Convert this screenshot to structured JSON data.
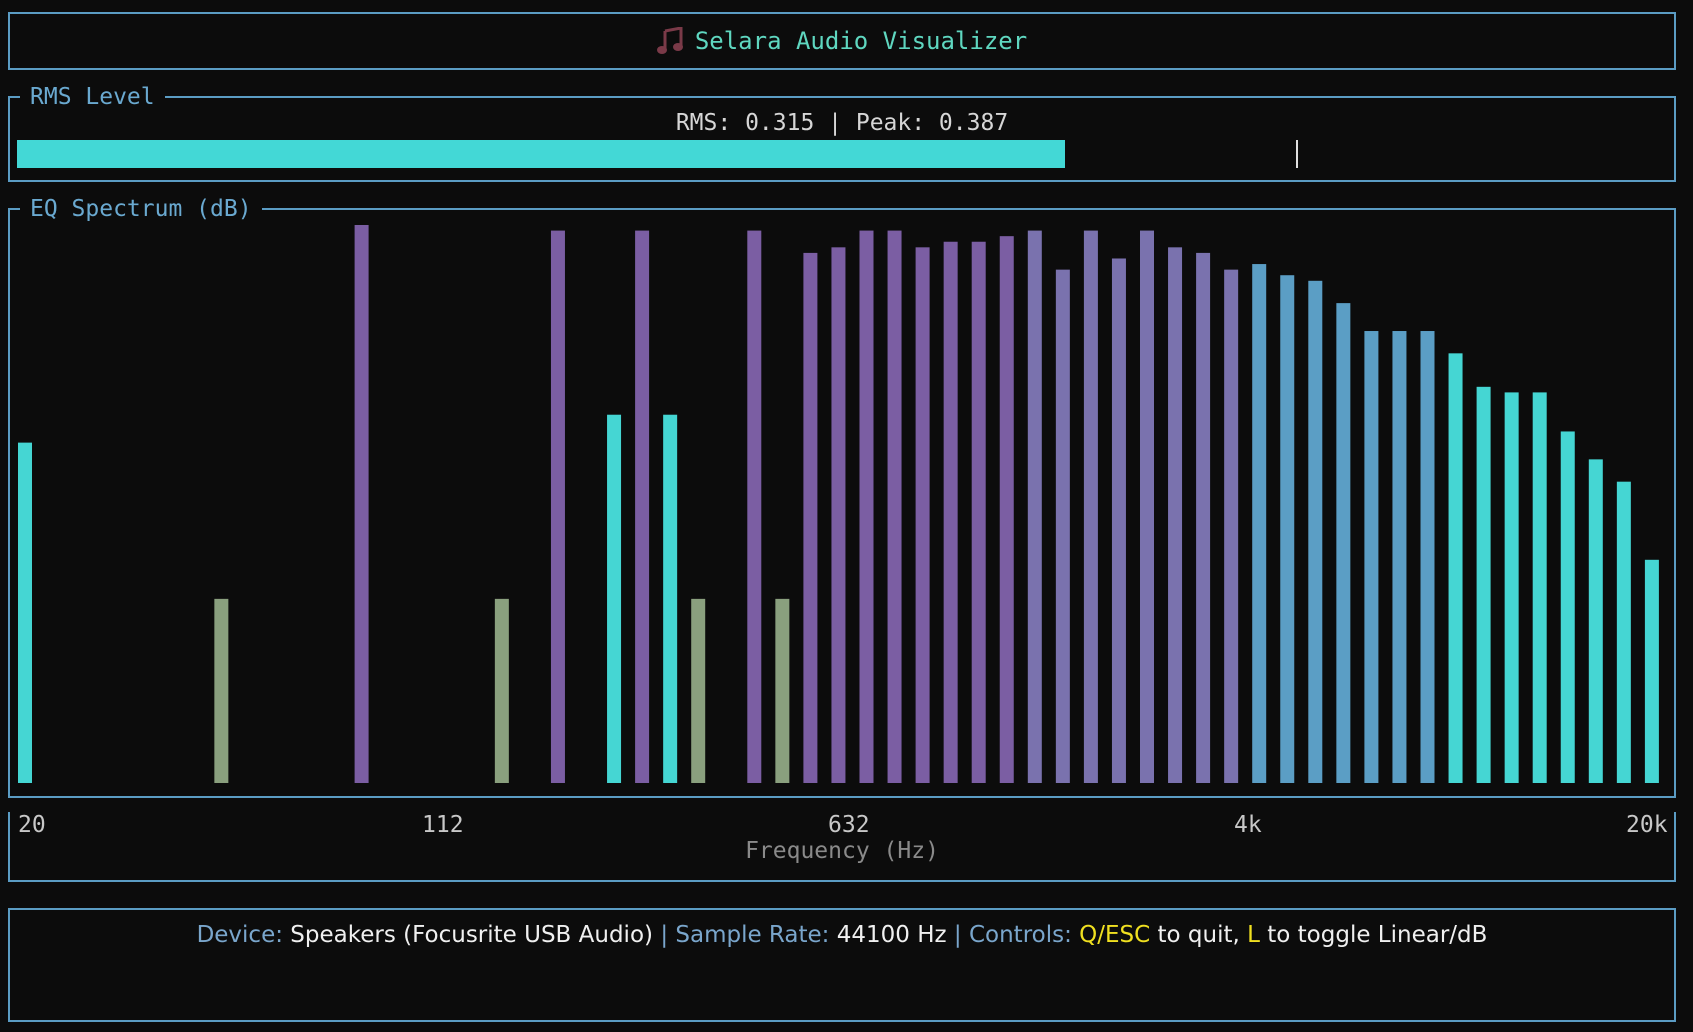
{
  "title": "Selara Audio Visualizer",
  "icons": {
    "title_icon": "music-note-icon"
  },
  "rms": {
    "panel_label": "RMS Level",
    "readout": "RMS: 0.315 | Peak: 0.387",
    "rms_value": 0.315,
    "peak_value": 0.387,
    "level_fill_fraction": 0.635,
    "peak_marker_fraction": 0.775
  },
  "eq": {
    "panel_label": "EQ Spectrum (dB)"
  },
  "axis": {
    "ticks": [
      "20",
      "112",
      "632",
      "4k",
      "20k"
    ],
    "title": "Frequency (Hz)"
  },
  "footer": {
    "device_label": "Device:",
    "device_value": "Speakers (Focusrite USB Audio)",
    "sep1": "|",
    "rate_label": "Sample Rate:",
    "rate_value": "44100 Hz",
    "sep2": "|",
    "controls_label": "Controls:",
    "key_quit": "Q/ESC",
    "quit_text": "to quit,",
    "key_toggle": "L",
    "toggle_text": "to toggle Linear/dB"
  },
  "chart_data": {
    "type": "bar",
    "title": "EQ Spectrum (dB)",
    "xlabel": "Frequency (Hz)",
    "ylabel": "",
    "x_tick_labels": [
      "20",
      "112",
      "632",
      "4k",
      "20k"
    ],
    "ylim": [
      0,
      1
    ],
    "values": [
      0.61,
      0,
      0,
      0,
      0,
      0,
      0,
      0.33,
      0,
      0,
      0,
      0,
      1.0,
      0,
      0,
      0,
      0,
      0.33,
      0,
      0.99,
      0,
      0.66,
      0.99,
      0.66,
      0.33,
      0,
      0.99,
      0.33,
      0.95,
      0.96,
      0.99,
      0.99,
      0.96,
      0.97,
      0.97,
      0.98,
      0.99,
      0.92,
      0.99,
      0.94,
      0.99,
      0.96,
      0.95,
      0.92,
      0.93,
      0.91,
      0.9,
      0.86,
      0.81,
      0.81,
      0.81,
      0.77,
      0.71,
      0.7,
      0.7,
      0.63,
      0.58,
      0.54,
      0.4
    ],
    "colors": [
      "#45d6d3",
      "#8aa07e",
      "#7b5ea3",
      "#7a72ae",
      "#5b9ec5"
    ]
  }
}
